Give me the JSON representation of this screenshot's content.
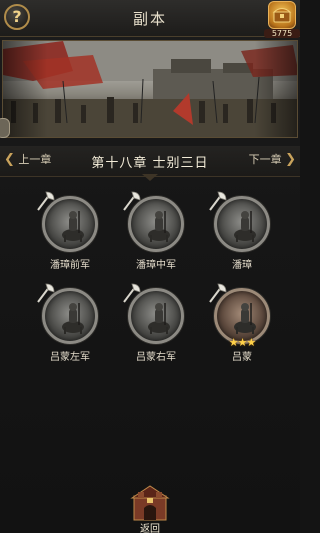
{
  "header": {
    "help_icon": "question-mark-icon",
    "help_glyph": "?",
    "title": "副本",
    "currency_icon": "treasure-chest-icon",
    "currency_value": "5775"
  },
  "chapter": {
    "prev_label": "上一章",
    "next_label": "下一章",
    "title": "第十八章 士别三日"
  },
  "stages": [
    {
      "name": "潘璋前军",
      "icon": "axe-icon",
      "stars": ""
    },
    {
      "name": "潘璋中军",
      "icon": "axe-icon",
      "stars": ""
    },
    {
      "name": "潘璋",
      "icon": "axe-icon",
      "stars": ""
    },
    {
      "name": "吕蒙左军",
      "icon": "axe-icon",
      "stars": ""
    },
    {
      "name": "吕蒙右军",
      "icon": "axe-icon",
      "stars": ""
    },
    {
      "name": "吕蒙",
      "icon": "axe-icon",
      "stars": "★★★"
    }
  ],
  "footer": {
    "return_label": "返回",
    "return_icon": "fortress-gate-icon"
  },
  "colors": {
    "accent_gold": "#c9a35c",
    "star_gold": "#ffd24a"
  }
}
